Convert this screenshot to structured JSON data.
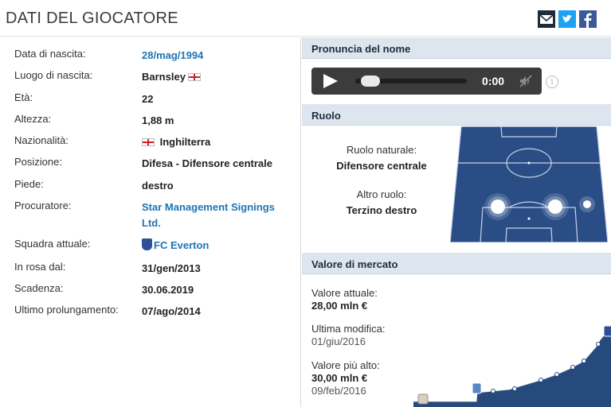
{
  "header": {
    "title": "DATI DEL GIOCATORE"
  },
  "social": [
    "email-icon",
    "twitter-icon",
    "facebook-icon"
  ],
  "details": [
    {
      "label": "Data di nascita:",
      "value": "28/mag/1994",
      "link": true
    },
    {
      "label": "Luogo di nascita:",
      "value": "Barnsley",
      "flag_after": true
    },
    {
      "label": "Età:",
      "value": "22"
    },
    {
      "label": "Altezza:",
      "value": "1,88 m"
    },
    {
      "label": "Nazionalità:",
      "value": "Inghilterra",
      "flag_before": true
    },
    {
      "label": "Posizione:",
      "value": "Difesa - Difensore centrale"
    },
    {
      "label": "Piede:",
      "value": "destro"
    },
    {
      "label": "Procuratore:",
      "value": "Star Management Signings Ltd.",
      "link": true
    },
    {
      "label": "Squadra attuale:",
      "value": "FC Everton",
      "link": true,
      "crest": true
    },
    {
      "label": "In rosa dal:",
      "value": "31/gen/2013"
    },
    {
      "label": "Scadenza:",
      "value": "30.06.2019"
    },
    {
      "label": "Ultimo prolungamento:",
      "value": "07/ago/2014"
    }
  ],
  "pronuncia": {
    "heading": "Pronuncia del nome",
    "time": "0:00",
    "progress": 0
  },
  "ruolo": {
    "heading": "Ruolo",
    "natural_label": "Ruolo naturale:",
    "natural_value": "Difensore centrale",
    "other_label": "Altro ruolo:",
    "other_value": "Terzino destro"
  },
  "mercato": {
    "heading": "Valore di mercato",
    "current_label": "Valore attuale:",
    "current_value": "28,00 mln €",
    "modified_label": "Ultima modifica:",
    "modified_value": "01/giu/2016",
    "highest_label": "Valore più alto:",
    "highest_value": "30,00 mln €",
    "highest_date": "09/feb/2016"
  },
  "colors": {
    "link": "#1d75b3",
    "section_bg": "#dde6ee",
    "pitch": "#2a4d86",
    "chart_fill": "#274a7d"
  }
}
